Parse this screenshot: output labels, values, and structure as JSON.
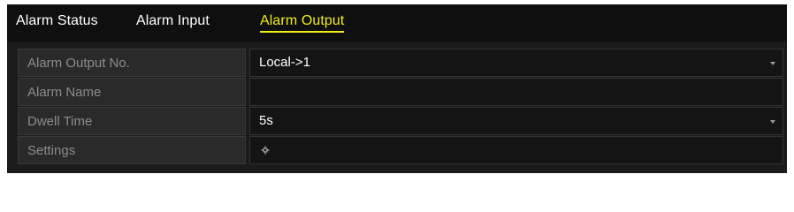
{
  "tabs": [
    {
      "label": "Alarm Status",
      "active": false
    },
    {
      "label": "Alarm Input",
      "active": false
    },
    {
      "label": "Alarm Output",
      "active": true
    }
  ],
  "form": {
    "rows": [
      {
        "label": "Alarm Output No.",
        "value": "Local->1",
        "control": "dropdown"
      },
      {
        "label": "Alarm Name",
        "value": "",
        "control": "text-input"
      },
      {
        "label": "Dwell Time",
        "value": "5s",
        "control": "dropdown"
      },
      {
        "label": "Settings",
        "value": "",
        "control": "settings-button",
        "icon": "gear-icon"
      }
    ]
  },
  "colors": {
    "active_tab": "#f2ec1a",
    "background": "#1b1b1b"
  }
}
